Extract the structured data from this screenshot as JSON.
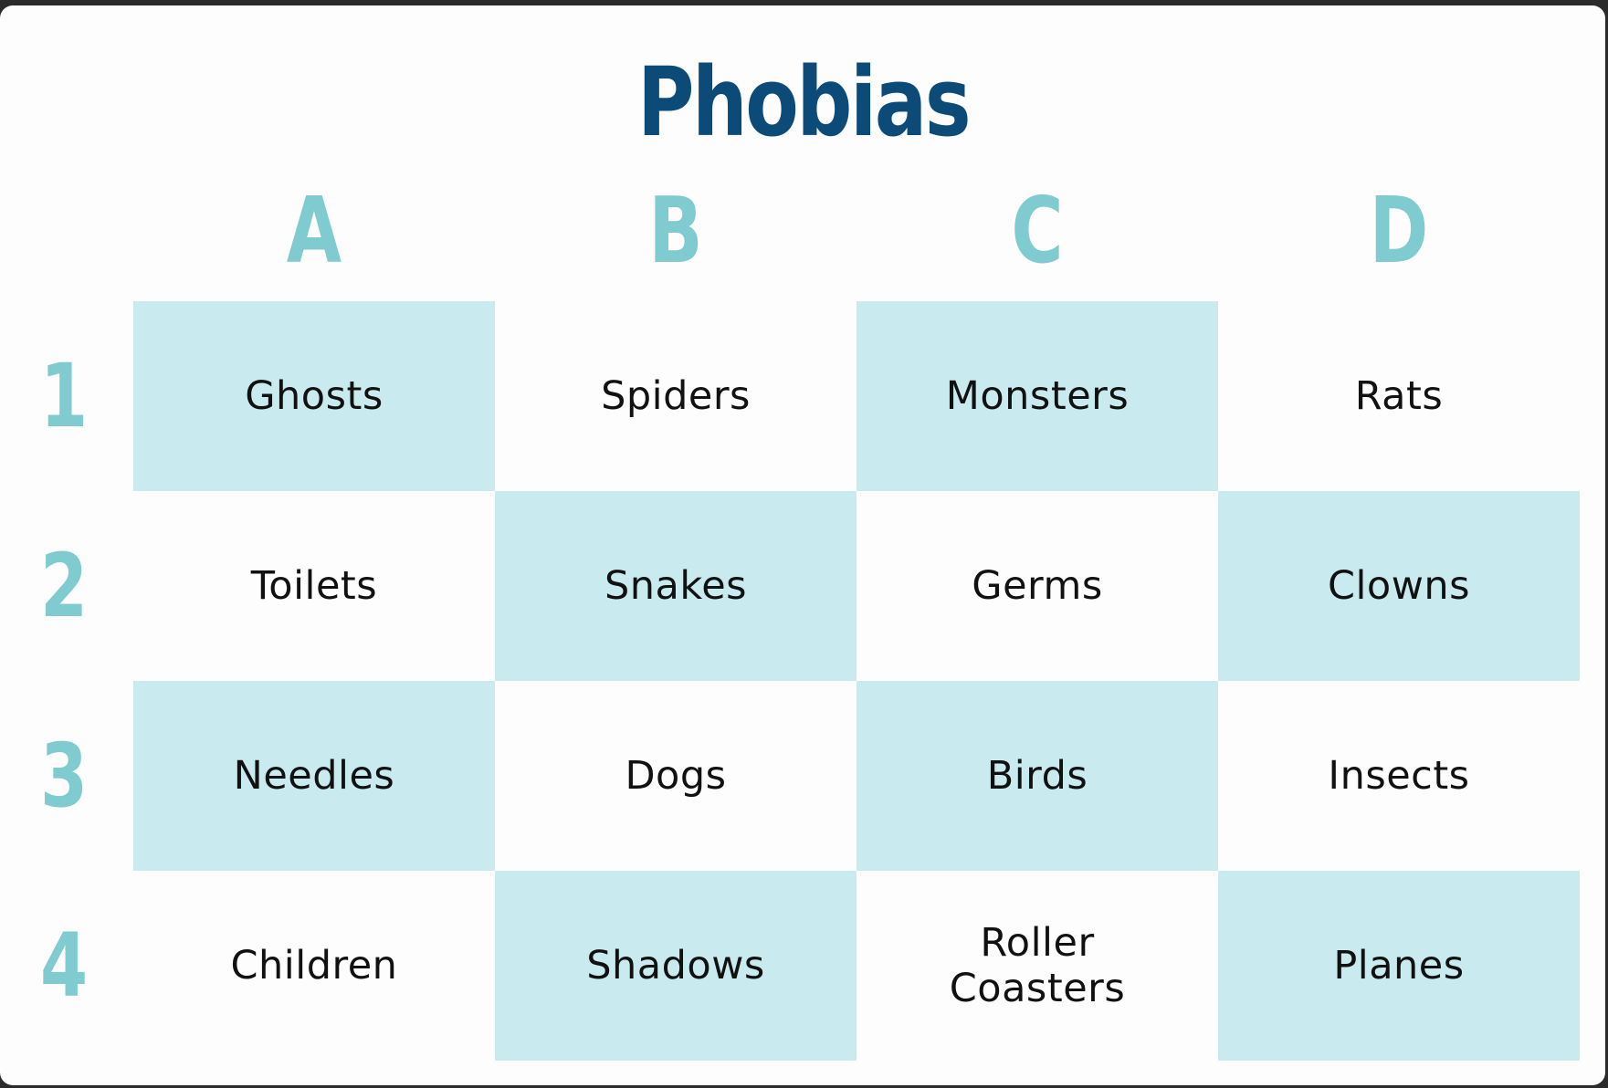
{
  "title": "Phobias",
  "columns": [
    "A",
    "B",
    "C",
    "D"
  ],
  "rows": [
    "1",
    "2",
    "3",
    "4"
  ],
  "cells": [
    [
      "Ghosts",
      "Spiders",
      "Monsters",
      "Rats"
    ],
    [
      "Toilets",
      "Snakes",
      "Germs",
      "Clowns"
    ],
    [
      "Needles",
      "Dogs",
      "Birds",
      "Insects"
    ],
    [
      "Children",
      "Shadows",
      "Roller Coasters",
      "Planes"
    ]
  ],
  "colors": {
    "title": "#0c4a78",
    "header": "#7fcbcf",
    "shaded_cell": "#c9ebf0",
    "text": "#111111",
    "background": "#fdfdfd"
  }
}
